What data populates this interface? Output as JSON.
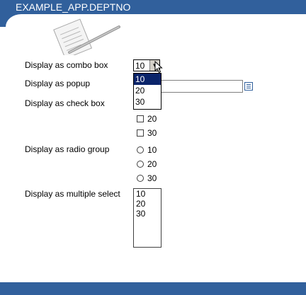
{
  "header": {
    "title": "EXAMPLE_APP.DEPTNO"
  },
  "labels": {
    "combo": "Display as combo box",
    "popup": "Display as popup",
    "checkbox": "Display as check box",
    "radio": "Display as radio group",
    "multi": "Display as multiple select"
  },
  "combo": {
    "value": "10",
    "options": [
      "10",
      "20",
      "30"
    ],
    "highlighted": "10"
  },
  "popup": {
    "value": ""
  },
  "checkboxes": [
    "20",
    "30"
  ],
  "radios": [
    "10",
    "20",
    "30"
  ],
  "multiselect": [
    "10",
    "20",
    "30"
  ],
  "icons": {
    "logo": "notepad-pencil-icon",
    "combo_arrow": "dropdown-arrow-icon",
    "popup_button": "list-of-values-icon",
    "cursor": "mouse-pointer-icon"
  },
  "colors": {
    "header": "#31609c",
    "selection": "#0a246a"
  }
}
